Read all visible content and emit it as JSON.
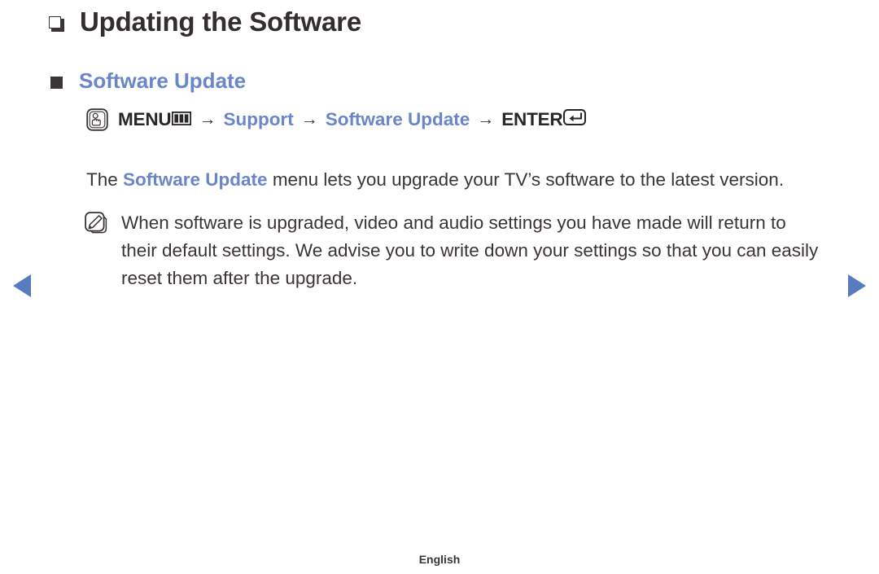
{
  "page": {
    "title": "Updating the Software",
    "footer_language": "English"
  },
  "section": {
    "heading": "Software Update"
  },
  "menu_path": {
    "press_icon": "press-button-icon",
    "menu_label": "MENU",
    "menu_glyph_icon": "menu-bars-icon",
    "arrow": "→",
    "step_support": "Support",
    "step_software_update": "Software Update",
    "enter_label": "ENTER",
    "enter_glyph_icon": "enter-return-icon"
  },
  "body": {
    "lead": "The ",
    "term": "Software Update",
    "rest": " menu lets you upgrade your TV’s software to the latest version."
  },
  "note": {
    "icon": "note-pencil-icon",
    "text": "When software is upgraded, video and audio settings you have made will return to their default settings. We advise you to write down your settings so that you can easily reset them after the upgrade."
  },
  "nav": {
    "prev_icon": "triangle-left-icon",
    "next_icon": "triangle-right-icon"
  },
  "colors": {
    "accent_blue": "#6a86c8",
    "nav_blue": "#5a7ac0",
    "text_dark": "#3a3436"
  }
}
